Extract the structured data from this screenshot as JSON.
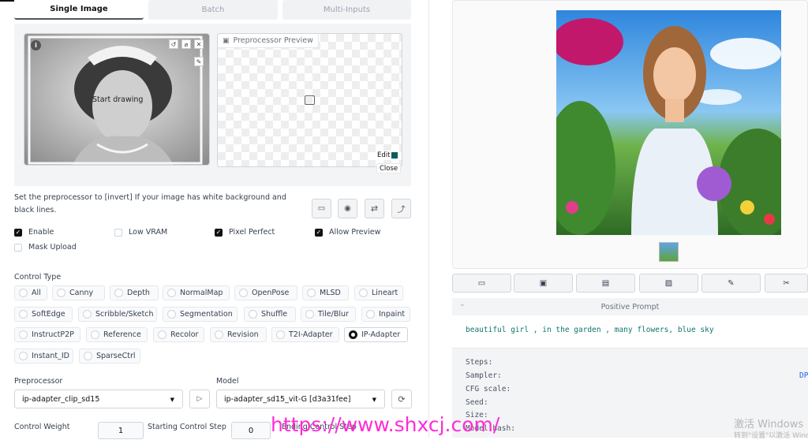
{
  "tabs": [
    {
      "label": "Single Image",
      "active": true
    },
    {
      "label": "Batch",
      "active": false
    },
    {
      "label": "Multi-Inputs",
      "active": false
    }
  ],
  "canvas": {
    "overlay_text": "Start drawing",
    "preview_label": "Preprocessor Preview",
    "edit_label": "Edit",
    "close_label": "Close"
  },
  "hint": "Set the preprocessor to [invert] If your image has white background and black lines.",
  "checkboxes": {
    "enable": {
      "label": "Enable",
      "checked": true
    },
    "low_vram": {
      "label": "Low VRAM",
      "checked": false
    },
    "pixel_perfect": {
      "label": "Pixel Perfect",
      "checked": true
    },
    "allow_preview": {
      "label": "Allow Preview",
      "checked": true
    },
    "mask_upload": {
      "label": "Mask Upload",
      "checked": false
    }
  },
  "control_type": {
    "label": "Control Type",
    "options": [
      "All",
      "Canny",
      "Depth",
      "NormalMap",
      "OpenPose",
      "MLSD",
      "Lineart",
      "SoftEdge",
      "Scribble/Sketch",
      "Segmentation",
      "Shuffle",
      "Tile/Blur",
      "Inpaint",
      "InstructP2P",
      "Reference",
      "Recolor",
      "Revision",
      "T2I-Adapter",
      "IP-Adapter",
      "Instant_ID",
      "SparseCtrl"
    ],
    "selected": "IP-Adapter"
  },
  "preprocessor": {
    "label": "Preprocessor",
    "value": "ip-adapter_clip_sd15"
  },
  "model": {
    "label": "Model",
    "value": "ip-adapter_sd15_vit-G [d3a31fee]"
  },
  "control_weight": {
    "label": "Control Weight",
    "value": "1"
  },
  "starting_step": {
    "label": "Starting Control Step",
    "value": "0"
  },
  "ending_step": {
    "label": "Ending Control Step"
  },
  "output": {
    "positive_prompt_label": "Positive Prompt",
    "prompt_text": "beautiful girl , in the garden , many flowers, blue sky",
    "params": [
      "Steps:",
      "Sampler:",
      "CFG scale:",
      "Seed:",
      "Size:",
      "Model hash:"
    ],
    "right_clip": "DP"
  },
  "watermark": {
    "url": "https://www.shxcj.com/",
    "activate_title": "激活 Windows",
    "activate_sub": "转到\"设置\"以激活 Windows。"
  },
  "colors": {
    "accent": "#111111",
    "prompt": "#0f766e",
    "watermark": "#ff2bd6"
  }
}
